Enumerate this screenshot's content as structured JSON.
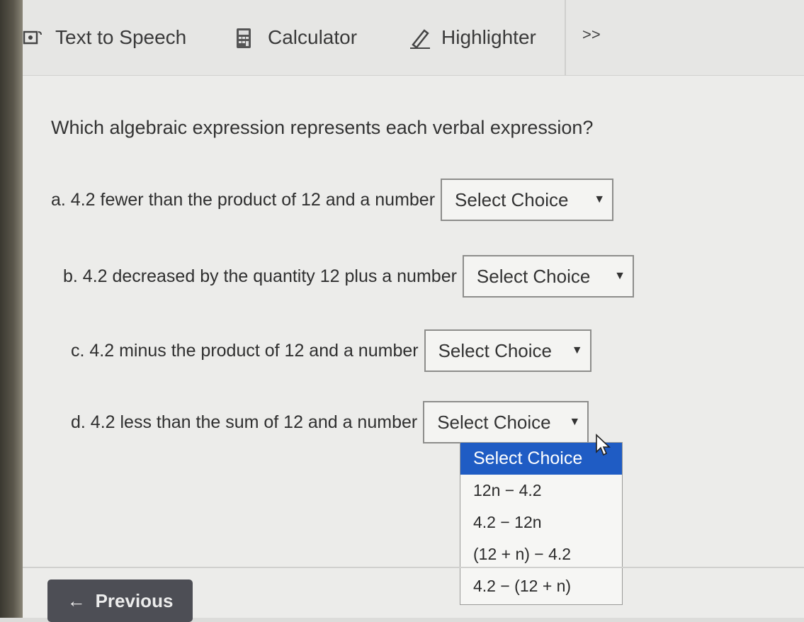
{
  "toolbar": {
    "text_to_speech": "Text to Speech",
    "calculator": "Calculator",
    "highlighter": "Highlighter",
    "more": ">>"
  },
  "question": "Which algebraic expression represents each verbal expression?",
  "items": [
    {
      "text": "a. 4.2 fewer than the product of 12 and a number",
      "select": "Select Choice"
    },
    {
      "text": "b. 4.2 decreased by the quantity 12 plus a number",
      "select": "Select Choice"
    },
    {
      "text": "c. 4.2 minus the product of 12 and a number",
      "select": "Select Choice"
    },
    {
      "text": "d. 4.2 less than the sum of 12 and a number",
      "select": "Select Choice"
    }
  ],
  "dropdown_options": [
    "Select Choice",
    "12n − 4.2",
    "4.2 − 12n",
    "(12 + n) − 4.2",
    "4.2 − (12 + n)"
  ],
  "nav": {
    "previous": "Previous",
    "previous_arrow": "←"
  },
  "colors": {
    "selected_option": "#1f5cc4",
    "previous_button": "#4d4e55"
  }
}
